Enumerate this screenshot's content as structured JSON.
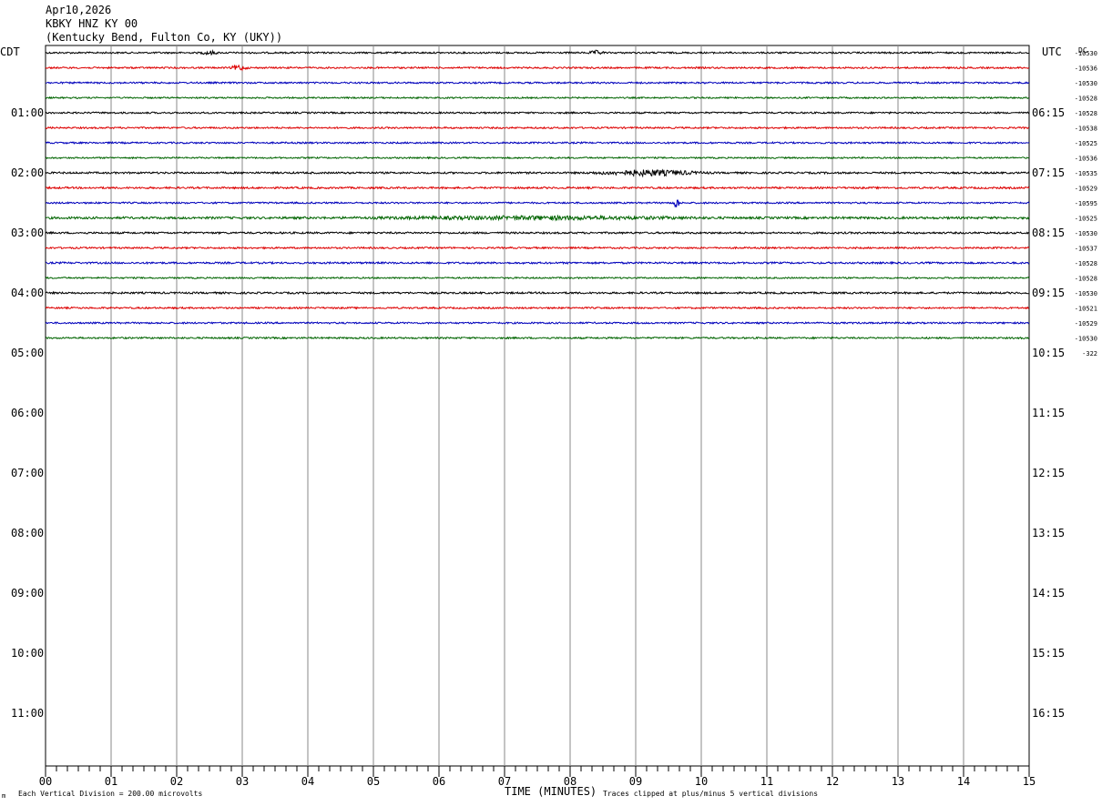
{
  "header": {
    "date": "Apr10,2026",
    "station": "KBKY HNZ KY 00",
    "location": "(Kentucky Bend, Fulton Co, KY (UKY))"
  },
  "chart_data": {
    "type": "line",
    "title": "Apr10,2026 KBKY HNZ KY 00",
    "left_timezone": "CDT",
    "right_timezone": "UTC",
    "dc_header": "DC",
    "xlabel": "TIME (MINUTES)",
    "x_ticks": [
      "00",
      "01",
      "02",
      "03",
      "04",
      "05",
      "06",
      "07",
      "08",
      "09",
      "10",
      "11",
      "12",
      "13",
      "14",
      "15"
    ],
    "xlim": [
      0,
      15
    ],
    "minutes_per_line": 15,
    "hour_labels_left": [
      "01:00",
      "02:00",
      "03:00",
      "04:00",
      "05:00",
      "06:00",
      "07:00",
      "08:00",
      "09:00",
      "10:00",
      "11:00"
    ],
    "hour_labels_right": [
      "06:15",
      "07:15",
      "08:15",
      "09:15",
      "10:15",
      "11:15",
      "12:15",
      "13:15",
      "14:15",
      "15:15",
      "16:15"
    ],
    "trace_colors": [
      "#000000",
      "#dd0000",
      "#0000bb",
      "#006400"
    ],
    "dc_offsets": [
      "-10530",
      "-10536",
      "-10530",
      "-10528",
      "-10528",
      "-10538",
      "-10525",
      "-10536",
      "-10535",
      "-10529",
      "-10595",
      "-10525",
      "-10530",
      "-10537",
      "-10528",
      "-10528",
      "-10530",
      "-10521",
      "-10529",
      "-10530",
      "-322"
    ],
    "traces": [
      {
        "row": 0,
        "color_index": 0,
        "amplitude": 0.9,
        "events": [
          {
            "minute": 2.5,
            "amp": 2
          },
          {
            "minute": 8.4,
            "amp": 2
          }
        ]
      },
      {
        "row": 1,
        "color_index": 1,
        "amplitude": 0.9,
        "events": [
          {
            "minute": 2.95,
            "amp": 3
          }
        ]
      },
      {
        "row": 2,
        "color_index": 2,
        "amplitude": 0.9,
        "events": []
      },
      {
        "row": 3,
        "color_index": 3,
        "amplitude": 0.8,
        "events": []
      },
      {
        "row": 4,
        "color_index": 0,
        "amplitude": 0.9,
        "events": []
      },
      {
        "row": 5,
        "color_index": 1,
        "amplitude": 0.9,
        "events": []
      },
      {
        "row": 6,
        "color_index": 2,
        "amplitude": 0.9,
        "events": []
      },
      {
        "row": 7,
        "color_index": 3,
        "amplitude": 0.8,
        "events": []
      },
      {
        "row": 8,
        "color_index": 0,
        "amplitude": 1.0,
        "events": [
          {
            "minute": 9.2,
            "amp": 3,
            "span": 1.0
          }
        ]
      },
      {
        "row": 9,
        "color_index": 1,
        "amplitude": 1.0,
        "events": []
      },
      {
        "row": 10,
        "color_index": 2,
        "amplitude": 0.9,
        "events": [
          {
            "minute": 9.62,
            "amp": 9,
            "span": 0.05
          }
        ]
      },
      {
        "row": 11,
        "color_index": 3,
        "amplitude": 1.2,
        "events": [
          {
            "minute": 7.5,
            "amp": 1.5,
            "span": 3
          }
        ]
      },
      {
        "row": 12,
        "color_index": 0,
        "amplitude": 1.0,
        "events": []
      },
      {
        "row": 13,
        "color_index": 1,
        "amplitude": 0.9,
        "events": []
      },
      {
        "row": 14,
        "color_index": 2,
        "amplitude": 1.0,
        "events": []
      },
      {
        "row": 15,
        "color_index": 3,
        "amplitude": 0.8,
        "events": []
      },
      {
        "row": 16,
        "color_index": 0,
        "amplitude": 1.0,
        "events": []
      },
      {
        "row": 17,
        "color_index": 1,
        "amplitude": 0.9,
        "events": []
      },
      {
        "row": 18,
        "color_index": 2,
        "amplitude": 0.9,
        "events": []
      },
      {
        "row": 19,
        "color_index": 3,
        "amplitude": 0.9,
        "events": []
      }
    ],
    "footer_scale": "Each Vertical Division =  200.00 microvolts",
    "footer_clip": "Traces clipped at plus/minus 5 vertical divisions",
    "footer_mark": "m"
  }
}
